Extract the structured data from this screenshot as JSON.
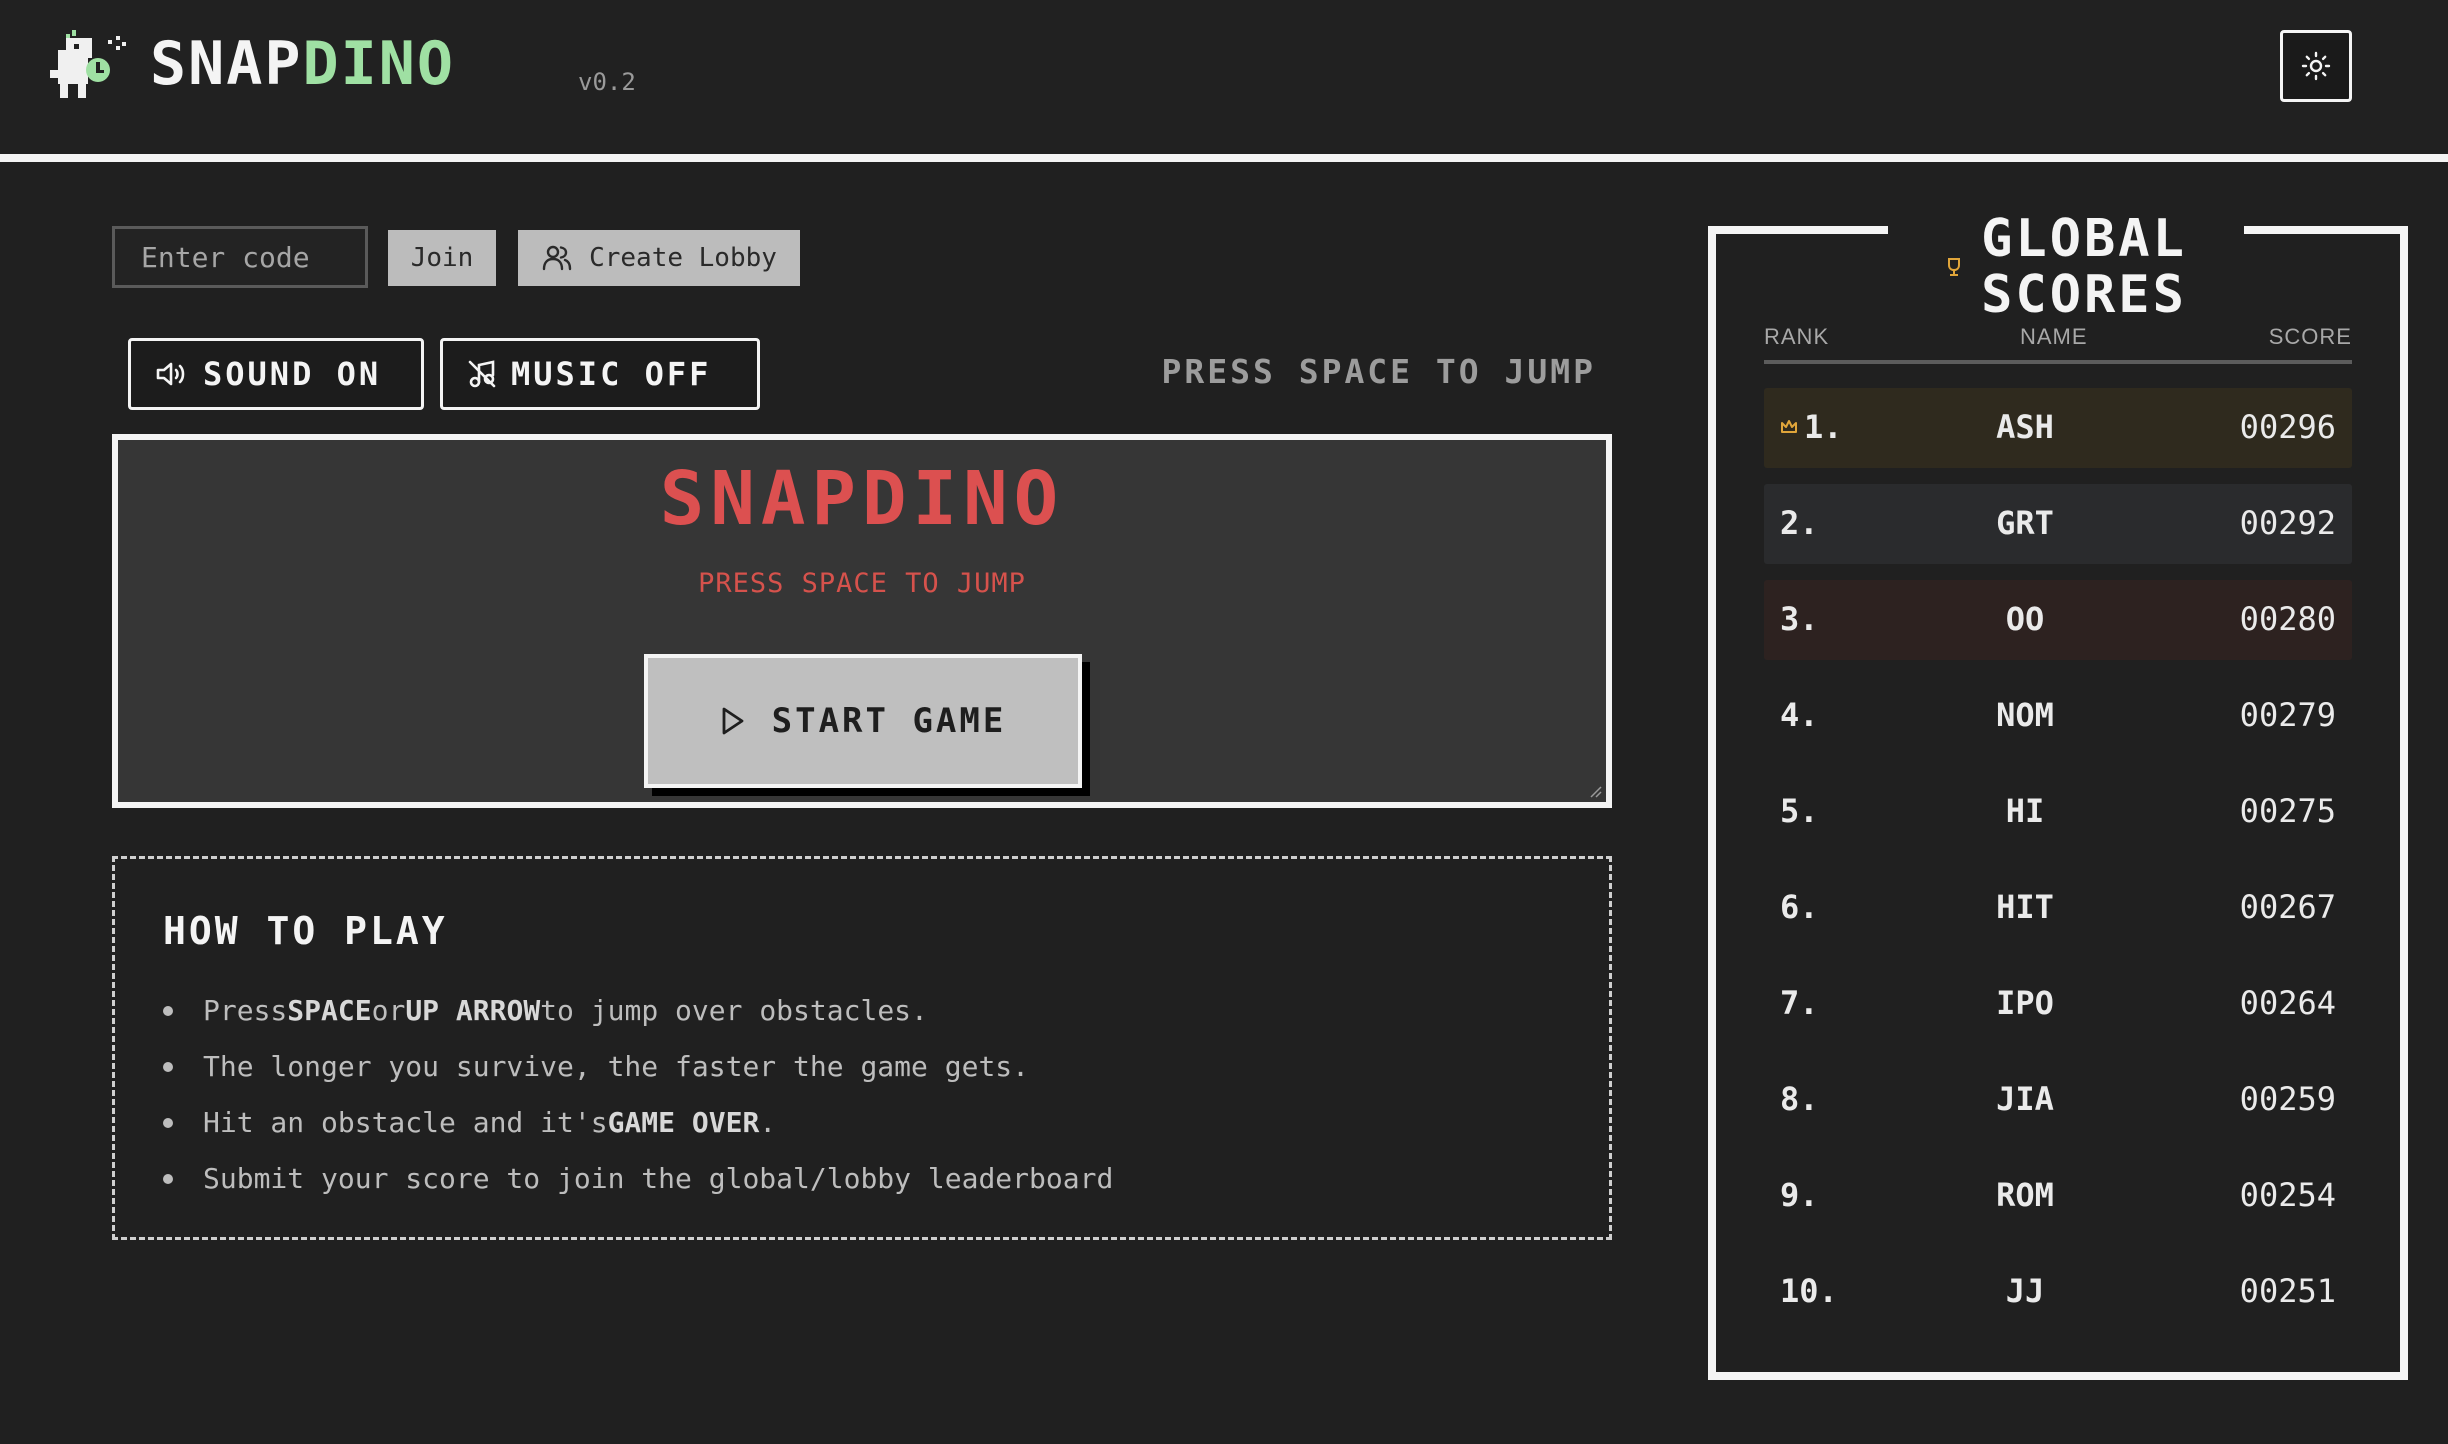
{
  "header": {
    "brand_main": "SNAP",
    "brand_accent": "DINO",
    "version": "v0.2",
    "theme_icon": "sun-icon"
  },
  "lobby": {
    "code_placeholder": "Enter code",
    "join_label": "Join",
    "create_label": "Create Lobby",
    "create_icon": "users-icon"
  },
  "controls": {
    "sound_label": "SOUND ON",
    "sound_icon": "speaker-icon",
    "music_label": "MUSIC OFF",
    "music_icon": "music-off-icon",
    "hint": "PRESS SPACE TO JUMP"
  },
  "game": {
    "title": "SNAPDINO",
    "subtitle": "PRESS SPACE TO JUMP",
    "start_label": "START GAME",
    "start_icon": "play-icon"
  },
  "how_to_play": {
    "title": "HOW TO PLAY",
    "items": [
      {
        "pre": "Press ",
        "b1": "SPACE",
        "mid": " or ",
        "b2": "UP ARROW",
        "post": " to jump over obstacles."
      },
      {
        "text": "The longer you survive, the faster the game gets."
      },
      {
        "pre": "Hit an obstacle and it's ",
        "b1": "GAME OVER",
        "post": "."
      },
      {
        "text": "Submit your score to join the global/lobby leaderboard"
      }
    ]
  },
  "leaderboard": {
    "title_line1": "GLOBAL",
    "title_line2": "SCORES",
    "col_rank": "RANK",
    "col_name": "NAME",
    "col_score": "SCORE",
    "rows": [
      {
        "rank": "1.",
        "name": "ASH",
        "score": "00296"
      },
      {
        "rank": "2.",
        "name": "GRT",
        "score": "00292"
      },
      {
        "rank": "3.",
        "name": "OO",
        "score": "00280"
      },
      {
        "rank": "4.",
        "name": "NOM",
        "score": "00279"
      },
      {
        "rank": "5.",
        "name": "HI",
        "score": "00275"
      },
      {
        "rank": "6.",
        "name": "HIT",
        "score": "00267"
      },
      {
        "rank": "7.",
        "name": "IPO",
        "score": "00264"
      },
      {
        "rank": "8.",
        "name": "JIA",
        "score": "00259"
      },
      {
        "rank": "9.",
        "name": "ROM",
        "score": "00254"
      },
      {
        "rank": "10.",
        "name": "JJ",
        "score": "00251"
      }
    ]
  },
  "colors": {
    "background": "#202020",
    "accent_green": "#9fe0a3",
    "game_red": "#dc5050",
    "gold": "#e0a53a"
  }
}
